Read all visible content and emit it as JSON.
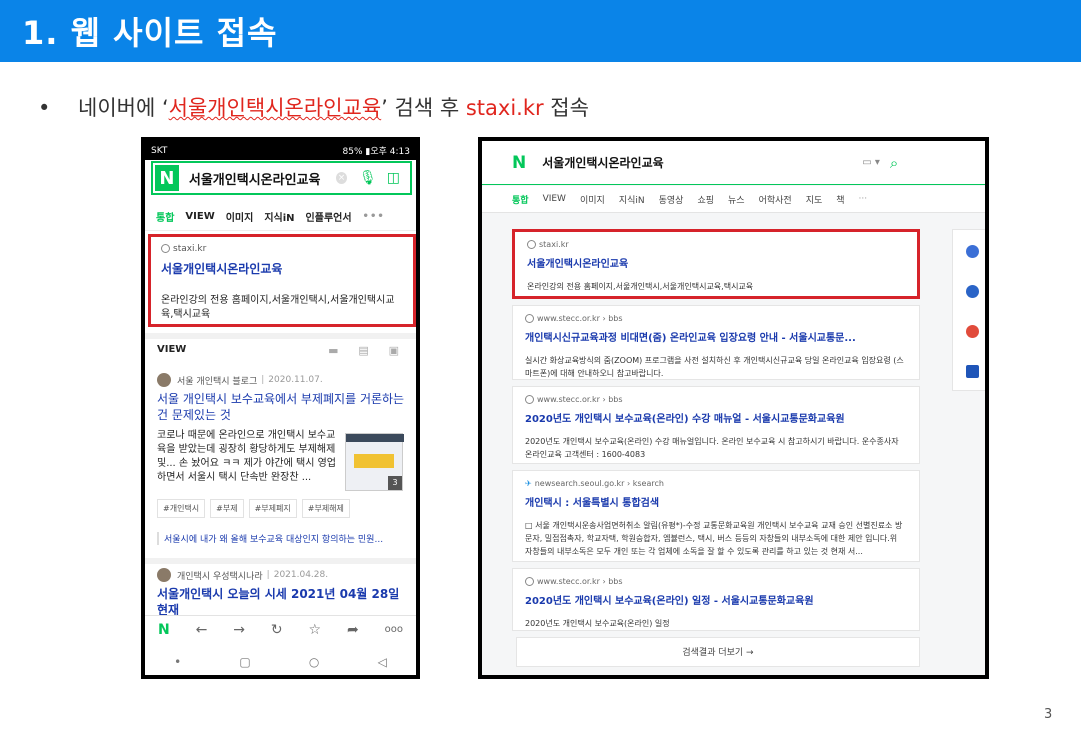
{
  "slide": {
    "title": "1. 웹 사이트 접속",
    "bullet": "•",
    "instruction_prefix": "네이버에 ‘",
    "instruction_keyword": "서울개인택시온라인교육",
    "instruction_mid": "’ 검색 후 ",
    "instruction_site": "staxi.kr",
    "instruction_suffix": " 접속",
    "page_number": "3"
  },
  "colors": {
    "header": "#0a84e8",
    "naver_green": "#03c75a",
    "highlight_red": "#d6232a",
    "link_blue": "#1a3aad"
  },
  "mobile": {
    "status_carrier": "SKT",
    "status_right": "85% ▮오후 4:13",
    "logo": "N",
    "query": "서울개인택시온라인교육",
    "clear_icon": "×",
    "mic_icon": "🎙",
    "cam_icon": "◫",
    "tabs": [
      "통합",
      "VIEW",
      "이미지",
      "지식iN",
      "인플루언서"
    ],
    "tabs_more": "•••",
    "top_result": {
      "site": "staxi.kr",
      "title": "서울개인택시온라인교육",
      "desc_plain": "온라인강의 전용 홈페이지,서울개인택시,서울개인택시교육,택시교육"
    },
    "view_label": "VIEW",
    "view_icons": "▬ ▤ ▣",
    "blog1": {
      "author": "서울 개인택시 블로그",
      "date": "2020.11.07.",
      "title": "서울 개인택시 보수교육에서 부제폐지를 거론하는 건 문제있는 것",
      "body": "코로나 때문에 온라인으로 개인택시 보수교육을 받았는데 굉장히 황당하게도 부제해제 및... 손 놨어요 ㅋㅋ 제가 야간에 택시 영업하면서 서울시 택시 단속반 완장찬 ...",
      "thumb_count": "3",
      "tags": [
        "#개인택시",
        "#부제",
        "#부제폐지",
        "#부제해제"
      ],
      "related": "서울시에 내가 왜 올해 보수교육 대상인지 항의하는 민원..."
    },
    "blog2": {
      "author": "개인택시 우성택시나라",
      "date": "2021.04.28.",
      "title": "서울개인택시 오늘의 시세 2021년 04월 28일 현재"
    },
    "bottom_nav": [
      "N",
      "←",
      "→",
      "↻",
      "☆",
      "➦",
      "ooo"
    ],
    "sys_nav": [
      "•",
      "▢",
      "○",
      "◁"
    ]
  },
  "desktop": {
    "logo": "N",
    "query": "서울개인택시온라인교육",
    "kb_label": "▭ ▾",
    "search_icon": "⌕",
    "tabs": [
      "통합",
      "VIEW",
      "이미지",
      "지식iN",
      "동영상",
      "쇼핑",
      "뉴스",
      "어학사전",
      "지도",
      "책"
    ],
    "tabs_more": "···",
    "results": [
      {
        "site": "staxi.kr",
        "title": "서울개인택시온라인교육",
        "desc": "온라인강의 전용 홈페이지,서울개인택시,서울개인택시교육,택시교육"
      },
      {
        "site": "www.stecc.or.kr › bbs",
        "title": "개인택시신규교육과정 비대면(줌) 온라인교육 입장요령 안내 - 서울시교통문...",
        "desc": "실시간 화상교육방식의 줌(ZOOM) 프로그램을 사전 설치하신 후 개인택시신규교육 당일 온라인교육 입장요령 (스마트폰)에 대해 안내하오니 참고바랍니다."
      },
      {
        "site": "www.stecc.or.kr › bbs",
        "title": "2020년도 개인택시 보수교육(온라인) 수강 매뉴얼 - 서울시교통문화교육원",
        "desc": "2020년도 개인택시 보수교육(온라인) 수강 매뉴얼입니다. 온라인 보수교육 시 참고하시기 바랍니다. 운수종사자 온라인교육 고객센터 : 1600-4083"
      },
      {
        "site": "newsearch.seoul.go.kr › ksearch",
        "title": "개인택시 : 서울특별시 통합검색",
        "desc": "□ 서울 개인택시운송사업면허취소 알림(유평*)-수정 교통문화교육원 개인택시 보수교육 교재 승인 선별진료소 방문자, 밀접접촉자, 학교자택, 학원승합자, 엠뷸런스, 택시, 버스 등등의 자창들의 내부소독에 대한 제안 입니다.위 자창들의 내부소독은 모두 개인 또는 각 업체에 소독을 잘 할 수 있도록 관리를 하고 있는 것 현재 서..."
      },
      {
        "site": "www.stecc.or.kr › bbs",
        "title": "2020년도 개인택시 보수교육(온라인) 일정 - 서울시교통문화교육원",
        "desc": "2020년도 개인택시 보수교육(온라인) 일정"
      }
    ],
    "more_results": "검색결과 더보기 →",
    "side_icons": [
      "navigation-icon",
      "location-pin-icon",
      "ox-quiz-icon",
      "home-icon"
    ]
  }
}
